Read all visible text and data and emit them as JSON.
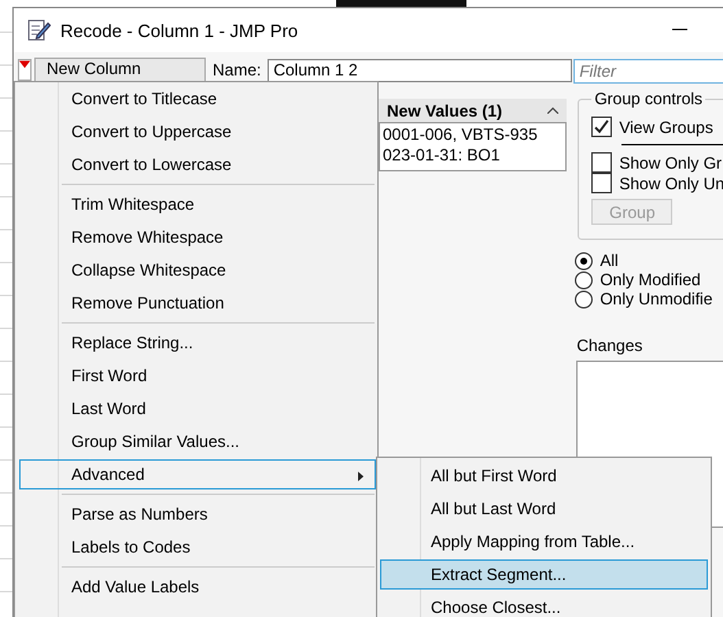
{
  "window": {
    "title": "Recode - Column 1 - JMP Pro"
  },
  "toolbar": {
    "column_dropdown": "New Column",
    "name_label": "Name:",
    "name_value": "Column 1 2",
    "filter_placeholder": "Filter"
  },
  "table": {
    "header": "New Values (1)",
    "rows": [
      "0001-006, VBTS-935",
      "023-01-31: BO1"
    ]
  },
  "group_controls": {
    "title": "Group controls",
    "checkboxes": [
      {
        "label": "View Groups",
        "checked": true
      },
      {
        "label": "Show Only Gr",
        "checked": false
      },
      {
        "label": "Show Only Un",
        "checked": false
      }
    ],
    "button": {
      "label": "Group",
      "disabled": true
    }
  },
  "show_options": [
    {
      "label": "All",
      "selected": true
    },
    {
      "label": "Only Modified",
      "selected": false
    },
    {
      "label": "Only Unmodifie",
      "selected": false
    }
  ],
  "changes": {
    "label": "Changes"
  },
  "menu": {
    "items": [
      {
        "kind": "item",
        "label": "Convert to Titlecase",
        "selected": false
      },
      {
        "kind": "item",
        "label": "Convert to Uppercase",
        "selected": false
      },
      {
        "kind": "item",
        "label": "Convert to Lowercase",
        "selected": false
      },
      {
        "kind": "separator"
      },
      {
        "kind": "item",
        "label": "Trim Whitespace",
        "selected": false
      },
      {
        "kind": "item",
        "label": "Remove Whitespace",
        "selected": false
      },
      {
        "kind": "item",
        "label": "Collapse Whitespace",
        "selected": false
      },
      {
        "kind": "item",
        "label": "Remove Punctuation",
        "selected": false
      },
      {
        "kind": "separator"
      },
      {
        "kind": "item",
        "label": "Replace String...",
        "selected": false
      },
      {
        "kind": "item",
        "label": "First Word",
        "selected": false
      },
      {
        "kind": "item",
        "label": "Last Word",
        "selected": false
      },
      {
        "kind": "item",
        "label": "Group Similar Values...",
        "selected": false
      },
      {
        "kind": "submenu",
        "label": "Advanced",
        "selected": true
      },
      {
        "kind": "separator"
      },
      {
        "kind": "item",
        "label": "Parse as Numbers",
        "selected": false
      },
      {
        "kind": "item",
        "label": "Labels to Codes",
        "selected": false
      },
      {
        "kind": "separator"
      },
      {
        "kind": "item",
        "label": "Add Value Labels",
        "selected": false
      }
    ]
  },
  "submenu": {
    "items": [
      {
        "label": "All but First Word",
        "selected": false
      },
      {
        "label": "All but Last Word",
        "selected": false
      },
      {
        "label": "Apply Mapping from Table...",
        "selected": false
      },
      {
        "label": "Extract Segment...",
        "selected": true
      },
      {
        "label": "Choose Closest...",
        "selected": false
      }
    ]
  }
}
